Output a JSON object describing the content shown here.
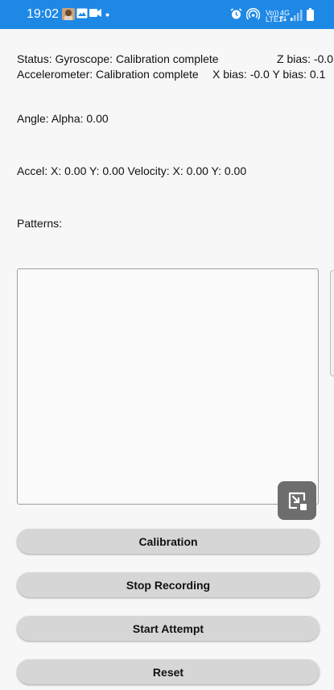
{
  "status_bar": {
    "time": "19:02",
    "icons": [
      "photo-avatar-icon",
      "gallery-icon",
      "video-camera-icon",
      "notification-dot-icon",
      "alarm-icon",
      "hotspot-icon",
      "volte-lte-icon",
      "signal-bars-icon",
      "battery-icon"
    ],
    "volte_label": "Vo))",
    "lte_label": "LTE1",
    "network_label": "4G"
  },
  "status": {
    "line1": "Status: Gyroscope: Calibration complete",
    "z_bias": "Z bias: -0.0",
    "line2": "Accelerometer: Calibration complete",
    "xy_bias": "X bias: -0.0 Y bias: 0.1"
  },
  "angle": "Angle: Alpha: 0.00",
  "motion": "Accel: X: 0.00  Y: 0.00  Velocity: X: 0.00  Y: 0.00",
  "patterns_label": "Patterns:",
  "buttons": {
    "calibration": "Calibration",
    "stop_recording": "Stop Recording",
    "start_attempt": "Start Attempt",
    "reset": "Reset"
  }
}
